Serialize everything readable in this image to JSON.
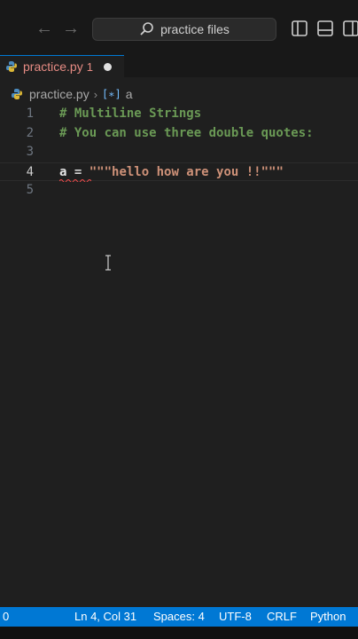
{
  "titlebar": {
    "search_text": "practice files",
    "back_icon": "arrow-left-icon",
    "forward_icon": "arrow-right-icon",
    "search_icon": "search-icon",
    "layout_icons": [
      "toggle-primary-sidebar-icon",
      "toggle-panel-icon",
      "toggle-secondary-sidebar-icon"
    ]
  },
  "tab": {
    "filename": "practice.py",
    "problems": "1",
    "icon": "python-file-icon",
    "modified": true
  },
  "breadcrumb": {
    "file": "practice.py",
    "symbol_icon": "variable-icon",
    "symbol": "a"
  },
  "editor": {
    "lines": [
      {
        "number": "1",
        "text": "# Multiline Strings"
      },
      {
        "number": "2",
        "text": "# You can use three double quotes:"
      },
      {
        "number": "3",
        "text": ""
      },
      {
        "number": "4",
        "var": "a",
        "op": " = ",
        "str": "\"\"\"hello how are you !!\"\"\""
      },
      {
        "number": "5",
        "text": ""
      }
    ],
    "current_line": "4"
  },
  "statusbar": {
    "problems": "0",
    "position": "Ln 4, Col 31",
    "indent": "Spaces: 4",
    "encoding": "UTF-8",
    "eol": "CRLF",
    "language": "Python"
  },
  "colors": {
    "accent": "#0078d4",
    "comment": "#6a9955",
    "string": "#ce9178",
    "error_tab": "#e78c84"
  }
}
